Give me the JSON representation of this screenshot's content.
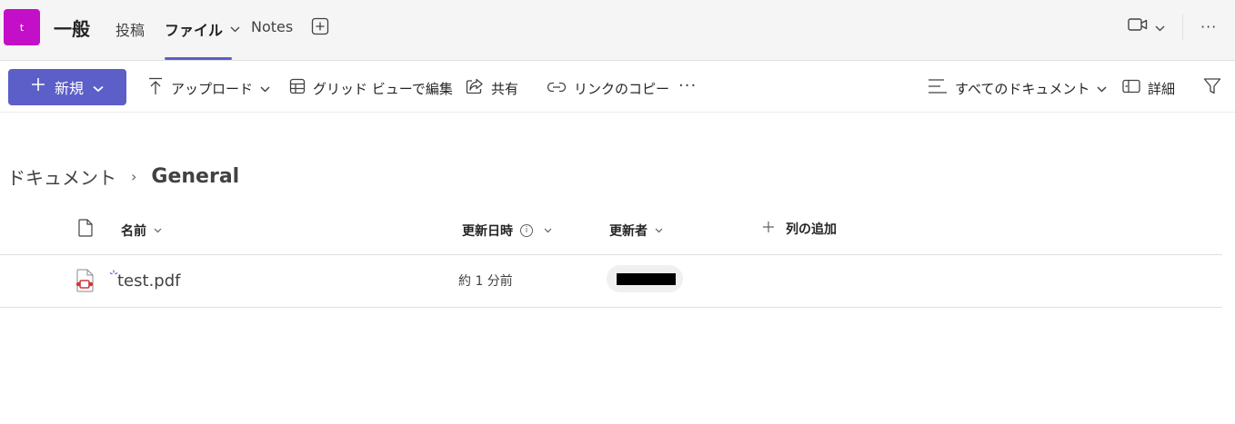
{
  "header": {
    "team_initial": "t",
    "channel_name": "一般",
    "tabs": [
      {
        "label": "投稿"
      },
      {
        "label": "ファイル"
      },
      {
        "label": "Notes"
      }
    ],
    "more_label": "···"
  },
  "command_bar": {
    "new_label": "新規",
    "upload_label": "アップロード",
    "grid_edit_label": "グリッド ビューで編集",
    "share_label": "共有",
    "copy_link_label": "リンクのコピー",
    "more_label": "···",
    "view_label": "すべてのドキュメント",
    "details_label": "詳細"
  },
  "breadcrumb": {
    "root": "ドキュメント",
    "separator": "›",
    "current": "General"
  },
  "table": {
    "columns": {
      "name": "名前",
      "modified": "更新日時",
      "modified_by": "更新者",
      "add_column": "列の追加"
    },
    "rows": [
      {
        "name": "test.pdf",
        "modified": "約 1 分前",
        "modified_by": "████████"
      }
    ]
  },
  "colors": {
    "accent": "#5b5fc7",
    "team_avatar": "#c30fc8",
    "pdf_icon": "#d13438"
  }
}
